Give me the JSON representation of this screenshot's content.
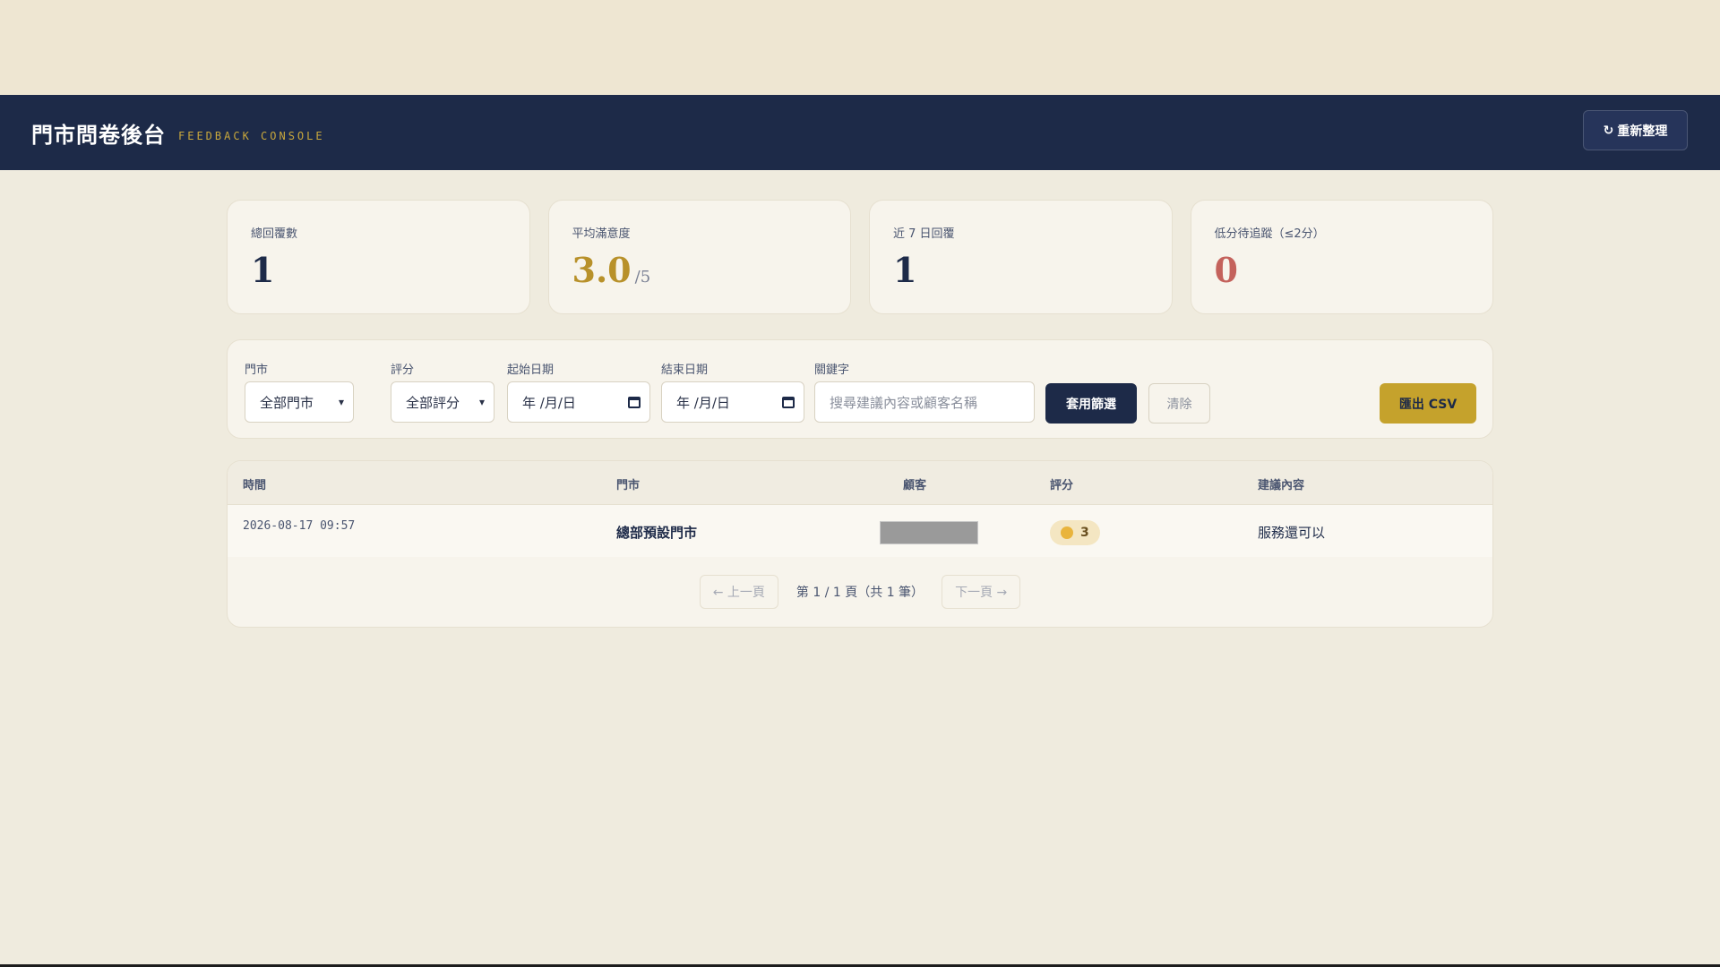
{
  "header": {
    "title": "門市問卷後台",
    "subtitle": "FEEDBACK CONSOLE",
    "refresh_icon": "↻",
    "refresh_label": "重新整理"
  },
  "stats": [
    {
      "label": "總回覆數",
      "value": "1",
      "suffix": ""
    },
    {
      "label": "平均滿意度",
      "value": "3.0",
      "suffix": "/5"
    },
    {
      "label": "近 7 日回覆",
      "value": "1",
      "suffix": ""
    },
    {
      "label": "低分待追蹤（≤2分）",
      "value": "0",
      "suffix": ""
    }
  ],
  "filters": {
    "store_label": "門市",
    "store_value": "全部門市",
    "rating_label": "評分",
    "rating_value": "全部評分",
    "start_label": "起始日期",
    "start_value": "年 /月/日",
    "end_label": "結束日期",
    "end_value": "年 /月/日",
    "keyword_label": "關鍵字",
    "keyword_placeholder": "搜尋建議內容或顧客名稱",
    "apply_label": "套用篩選",
    "clear_label": "清除",
    "export_label": "匯出 CSV"
  },
  "table": {
    "columns": [
      "時間",
      "門市",
      "顧客",
      "評分",
      "建議內容"
    ],
    "rows": [
      {
        "time": "2026-08-17 09:57",
        "store": "總部預設門市",
        "rating": "3",
        "comment": "服務還可以"
      }
    ]
  },
  "pager": {
    "prev_label": "← 上一頁",
    "info": "第 1 / 1 頁（共 1 筆）",
    "next_label": "下一頁 →"
  },
  "colors": {
    "navy": "#1d2a48",
    "gold": "#c5a22c",
    "red": "#c4625c",
    "background": "#efebde"
  }
}
